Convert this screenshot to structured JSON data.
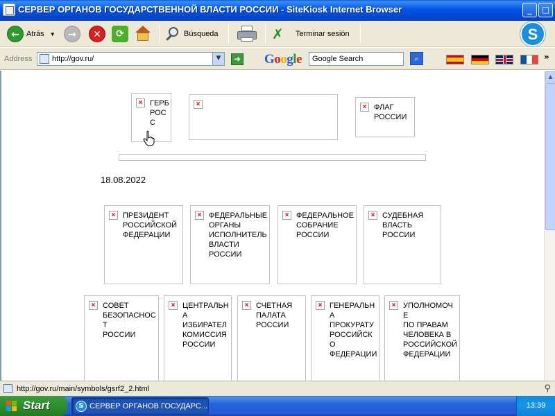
{
  "window": {
    "title": "СЕРВЕР ОРГАНОВ ГОСУДАРСТВЕННОЙ ВЛАСТИ РОССИИ - SiteKiosk Internet Browser",
    "minimize_glyph": "_",
    "maximize_glyph": "□",
    "close_glyph": "✕"
  },
  "toolbar": {
    "back_label": "Atrás",
    "search_label": "Búsqueda",
    "end_session_label": "Terminar sesión",
    "skype_glyph": "S"
  },
  "address_bar": {
    "label": "Address",
    "url": "http://gov.ru/",
    "google_logo": "Google",
    "google_search_value": "Google Search",
    "more_glyph": "»"
  },
  "page": {
    "top_boxes": [
      {
        "text": "ГЕРБ\nРОСС"
      },
      {
        "text": ""
      },
      {
        "text": "ФЛАГ\nРОССИИ"
      }
    ],
    "date": "18.08.2022",
    "row1": [
      {
        "text": "ПРЕЗИДЕНТ\nРОССИЙСКОЙ\nФЕДЕРАЦИИ"
      },
      {
        "text": "ФЕДЕРАЛЬНЫЕ\nОРГАНЫ\nИСПОЛНИТЕЛЬ\nВЛАСТИ\nРОССИИ"
      },
      {
        "text": "ФЕДЕРАЛЬНОЕ\nСОБРАНИЕ\nРОССИИ"
      },
      {
        "text": "СУДЕБНАЯ\nВЛАСТЬ\nРОССИИ"
      }
    ],
    "row2": [
      {
        "text": "СОВЕТ\nБЕЗОПАСНОСТ\nРОССИИ"
      },
      {
        "text": "ЦЕНТРАЛЬНА\nИЗБИРАТЕЛ\nКОМИССИЯ\nРОССИИ"
      },
      {
        "text": "СЧЕТНАЯ\nПАЛАТА\nРОССИИ"
      },
      {
        "text": "ГЕНЕРАЛЬНА\nПРОКУРАТУ\nРОССИЙСКО\nФЕДЕРАЦИИ"
      },
      {
        "text": "УПОЛНОМОЧЕ\nПО ПРАВАМ\nЧЕЛОВЕКА В\nРОССИЙСКОЙ\nФЕДЕРАЦИИ"
      }
    ],
    "broken_image_glyph": "×"
  },
  "status": {
    "text": "http://gov.ru/main/symbols/gsrf2_2.html"
  },
  "taskbar": {
    "start_label": "Start",
    "task_label": "СЕРВЕР ОРГАНОВ ГОСУДАРС...",
    "clock": "13:39"
  },
  "colors": {
    "title_bar": "#0054e3",
    "taskbar": "#245edb",
    "start_button": "#2e8f2e",
    "broken_image_x": "#dd0000"
  }
}
